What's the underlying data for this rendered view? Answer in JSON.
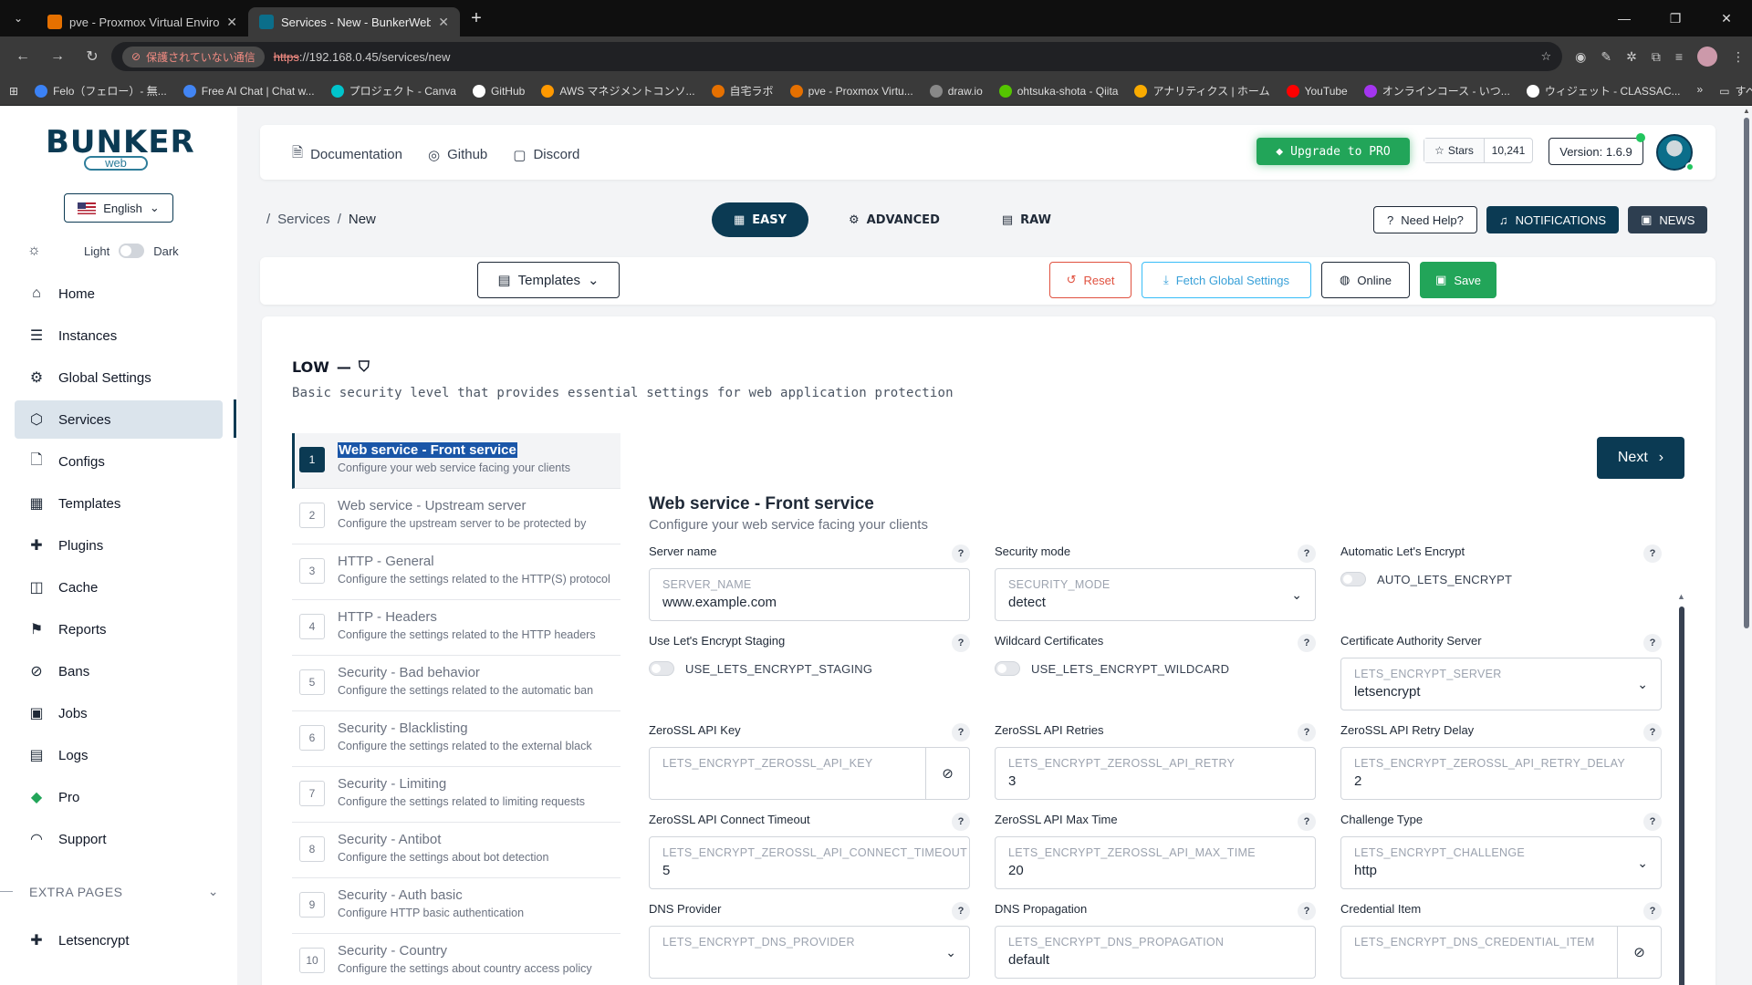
{
  "browser": {
    "tabs": [
      {
        "title": "pve - Proxmox Virtual Environm",
        "color": "#e57000"
      },
      {
        "title": "Services - New - BunkerWeb UI",
        "color": "#0b6e8a",
        "active": true
      }
    ],
    "insecure_label": "保護されていない通信",
    "url_scheme": "https",
    "url_rest": "://192.168.0.45/services/new",
    "bookmarks": [
      {
        "label": "Felo（フェロー）- 無...",
        "color": "#3b82f6"
      },
      {
        "label": "Free AI Chat | Chat w...",
        "color": "#4285f4"
      },
      {
        "label": "プロジェクト - Canva",
        "color": "#00c4cc"
      },
      {
        "label": "GitHub",
        "color": "#ffffff"
      },
      {
        "label": "AWS マネジメントコンソ...",
        "color": "#ff9900"
      },
      {
        "label": "自宅ラボ",
        "color": "#e57000"
      },
      {
        "label": "pve - Proxmox Virtu...",
        "color": "#e57000"
      },
      {
        "label": "draw.io",
        "color": "#888888"
      },
      {
        "label": "ohtsuka-shota - Qiita",
        "color": "#55c500"
      },
      {
        "label": "アナリティクス | ホーム",
        "color": "#f9ab00"
      },
      {
        "label": "YouTube",
        "color": "#ff0000"
      },
      {
        "label": "オンラインコース - いつ...",
        "color": "#a435f0"
      },
      {
        "label": "ウィジェット - CLASSAC...",
        "color": "#ffffff"
      }
    ],
    "bookmarks_all": "すべてのブックマーク",
    "bookmarks_more": "»"
  },
  "sidebar": {
    "logo_main": "BUNKER",
    "logo_sub": "web",
    "language": "English",
    "theme_light": "Light",
    "theme_dark": "Dark",
    "items": [
      {
        "label": "Home",
        "icon": "⌂"
      },
      {
        "label": "Instances",
        "icon": "☰"
      },
      {
        "label": "Global Settings",
        "icon": "⚙"
      },
      {
        "label": "Services",
        "icon": "⬡"
      },
      {
        "label": "Configs",
        "icon": "🗋"
      },
      {
        "label": "Templates",
        "icon": "▦"
      },
      {
        "label": "Plugins",
        "icon": "✚"
      },
      {
        "label": "Cache",
        "icon": "◫"
      },
      {
        "label": "Reports",
        "icon": "⚑"
      },
      {
        "label": "Bans",
        "icon": "⊘"
      },
      {
        "label": "Jobs",
        "icon": "▣"
      },
      {
        "label": "Logs",
        "icon": "▤"
      },
      {
        "label": "Pro",
        "icon": "◆"
      },
      {
        "label": "Support",
        "icon": "◠"
      }
    ],
    "extra_pages": "EXTRA PAGES",
    "extra_items": [
      {
        "label": "Letsencrypt",
        "icon": "✚"
      }
    ]
  },
  "header": {
    "documentation": "Documentation",
    "github": "Github",
    "discord": "Discord",
    "upgrade": "Upgrade to PRO",
    "stars_label": "Stars",
    "stars_count": "10,241",
    "version": "Version: 1.6.9"
  },
  "breadcrumb": {
    "root": "Services",
    "sep": "/",
    "current": "New"
  },
  "modes": {
    "easy": "EASY",
    "advanced": "ADVANCED",
    "raw": "RAW"
  },
  "help": {
    "need_help": "Need Help?",
    "notifications": "NOTIFICATIONS",
    "news": "NEWS"
  },
  "actions": {
    "templates": "Templates",
    "reset": "Reset",
    "fetch": "Fetch Global Settings",
    "online": "Online",
    "save": "Save"
  },
  "level": {
    "name": "LOW",
    "dash": "—",
    "description": "Basic security level that provides essential settings for web application protection"
  },
  "steps": [
    {
      "num": "1",
      "title": "Web service - Front service",
      "desc": "Configure your web service facing your clients",
      "active": true
    },
    {
      "num": "2",
      "title": "Web service - Upstream server",
      "desc": "Configure the upstream server to be protected by"
    },
    {
      "num": "3",
      "title": "HTTP - General",
      "desc": "Configure the settings related to the HTTP(S) protocol"
    },
    {
      "num": "4",
      "title": "HTTP - Headers",
      "desc": "Configure the settings related to the HTTP headers"
    },
    {
      "num": "5",
      "title": "Security - Bad behavior",
      "desc": "Configure the settings related to the automatic ban"
    },
    {
      "num": "6",
      "title": "Security - Blacklisting",
      "desc": "Configure the settings related to the external black"
    },
    {
      "num": "7",
      "title": "Security - Limiting",
      "desc": "Configure the settings related to limiting requests"
    },
    {
      "num": "8",
      "title": "Security - Antibot",
      "desc": "Configure the settings about bot detection"
    },
    {
      "num": "9",
      "title": "Security - Auth basic",
      "desc": "Configure HTTP basic authentication"
    },
    {
      "num": "10",
      "title": "Security - Country",
      "desc": "Configure the settings about country access policy"
    }
  ],
  "next": "Next",
  "form": {
    "title": "Web service - Front service",
    "subtitle": "Configure your web service facing your clients",
    "fields": [
      {
        "label": "Server name",
        "kind": "input",
        "placeholder": "SERVER_NAME",
        "value": "www.example.com"
      },
      {
        "label": "Security mode",
        "kind": "select",
        "placeholder": "SECURITY_MODE",
        "value": "detect"
      },
      {
        "label": "Automatic Let's Encrypt",
        "kind": "toggle",
        "placeholder": "AUTO_LETS_ENCRYPT",
        "value": ""
      },
      {
        "label": "Use Let's Encrypt Staging",
        "kind": "toggle",
        "placeholder": "USE_LETS_ENCRYPT_STAGING",
        "value": ""
      },
      {
        "label": "Wildcard Certificates",
        "kind": "toggle",
        "placeholder": "USE_LETS_ENCRYPT_WILDCARD",
        "value": ""
      },
      {
        "label": "Certificate Authority Server",
        "kind": "select",
        "placeholder": "LETS_ENCRYPT_SERVER",
        "value": "letsencrypt"
      },
      {
        "label": "ZeroSSL API Key",
        "kind": "password",
        "placeholder": "LETS_ENCRYPT_ZEROSSL_API_KEY",
        "value": ""
      },
      {
        "label": "ZeroSSL API Retries",
        "kind": "input",
        "placeholder": "LETS_ENCRYPT_ZEROSSL_API_RETRY",
        "value": "3"
      },
      {
        "label": "ZeroSSL API Retry Delay",
        "kind": "input",
        "placeholder": "LETS_ENCRYPT_ZEROSSL_API_RETRY_DELAY",
        "value": "2"
      },
      {
        "label": "ZeroSSL API Connect Timeout",
        "kind": "input",
        "placeholder": "LETS_ENCRYPT_ZEROSSL_API_CONNECT_TIMEOUT",
        "value": "5"
      },
      {
        "label": "ZeroSSL API Max Time",
        "kind": "input",
        "placeholder": "LETS_ENCRYPT_ZEROSSL_API_MAX_TIME",
        "value": "20"
      },
      {
        "label": "Challenge Type",
        "kind": "select",
        "placeholder": "LETS_ENCRYPT_CHALLENGE",
        "value": "http"
      },
      {
        "label": "DNS Provider",
        "kind": "select",
        "placeholder": "LETS_ENCRYPT_DNS_PROVIDER",
        "value": ""
      },
      {
        "label": "DNS Propagation",
        "kind": "input",
        "placeholder": "LETS_ENCRYPT_DNS_PROPAGATION",
        "value": "default"
      },
      {
        "label": "Credential Item",
        "kind": "password",
        "placeholder": "LETS_ENCRYPT_DNS_CREDENTIAL_ITEM",
        "value": ""
      }
    ]
  },
  "colors": {
    "brand": "#0b3a53",
    "success": "#22a559",
    "danger": "#e0513f",
    "info": "#38bdf8"
  }
}
